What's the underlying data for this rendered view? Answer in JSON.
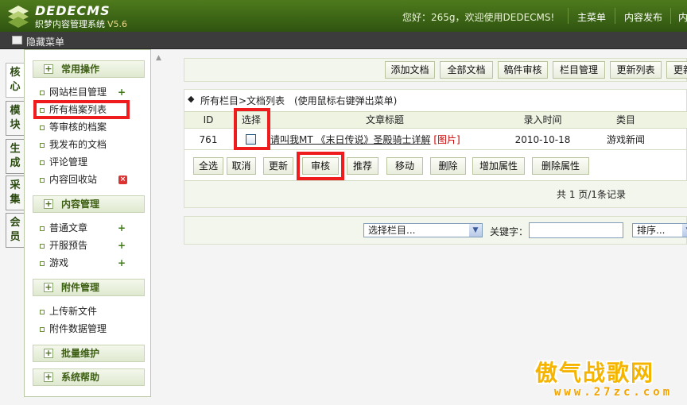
{
  "header": {
    "brand": "DEDECMS",
    "subtitle": "织梦内容管理系统",
    "version": "V5.6",
    "welcome": "您好：265g，欢迎使用DEDECMS!",
    "nav": [
      "主菜单",
      "内容发布",
      "内"
    ]
  },
  "toolbar": {
    "hide_menu": "隐藏菜单"
  },
  "vtabs": [
    "核心",
    "模块",
    "生成",
    "采集",
    "会员"
  ],
  "sidebar": {
    "sections": [
      {
        "title": "常用操作",
        "items": [
          "网站栏目管理",
          "所有档案列表",
          "等审核的档案",
          "我发布的文档",
          "评论管理",
          "内容回收站"
        ]
      },
      {
        "title": "内容管理",
        "items": [
          "普通文章",
          "开服预告",
          "游戏"
        ]
      },
      {
        "title": "附件管理",
        "items": [
          "上传新文件",
          "附件数据管理"
        ]
      },
      {
        "title": "批量维护",
        "items": []
      },
      {
        "title": "系统帮助",
        "items": []
      }
    ],
    "toggle": "+"
  },
  "top_buttons": [
    "添加文档",
    "全部文档",
    "稿件审核",
    "栏目管理",
    "更新列表",
    "更新"
  ],
  "list": {
    "breadcrumb": "所有栏目>文档列表",
    "hint": "(使用鼠标右键弹出菜单)",
    "columns": [
      "ID",
      "选择",
      "文章标题",
      "录入时间",
      "类目"
    ],
    "rows": [
      {
        "id": "761",
        "title": "请叫我MT 《末日传说》圣殿骑士详解",
        "tag": "[图片]",
        "date": "2010-10-18",
        "category": "游戏新闻"
      }
    ],
    "actions": [
      "全选",
      "取消",
      "更新",
      "审核",
      "推荐",
      "移动",
      "删除",
      "增加属性",
      "删除属性"
    ],
    "pagination": "共 1 页/1条记录"
  },
  "search": {
    "category_select": "选择栏目...",
    "keyword_label": "关键字：",
    "keyword_value": "",
    "sort_select": "排序..."
  },
  "watermark": {
    "main": "傲气战歌网",
    "url": "www.27zc.com"
  },
  "colors": {
    "header": "#3f6817",
    "highlight": "#ee1c1c",
    "accent": "#4a6a20"
  }
}
